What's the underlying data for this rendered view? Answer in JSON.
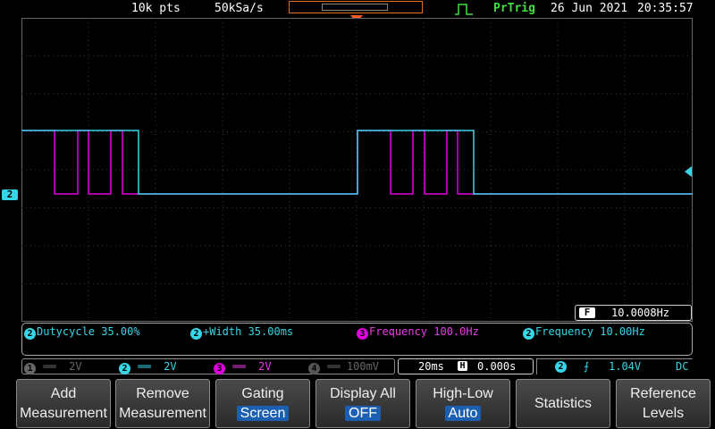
{
  "top_bar": {
    "points": "10k pts",
    "sample_rate": "50kSa/s",
    "trigger_status": "PrTrig",
    "date": "26 Jun 2021",
    "time": "20:35:57"
  },
  "channel_marker": "2",
  "frequency_counter": {
    "icon": "F",
    "value": "10.0008Hz"
  },
  "measurements": [
    {
      "channel": "2",
      "text": "Dutycycle 35.00%",
      "color": "#35d6e8"
    },
    {
      "channel": "2",
      "text": "+Width 35.00ms",
      "color": "#35d6e8"
    },
    {
      "channel": "3",
      "text": "Frequency 100.0Hz",
      "color": "#e83ce8"
    },
    {
      "channel": "2",
      "text": "Frequency 10.00Hz",
      "color": "#35d6e8"
    }
  ],
  "channel_status": [
    {
      "ch": "1",
      "scale": "2V"
    },
    {
      "ch": "2",
      "scale": "2V"
    },
    {
      "ch": "3",
      "scale": "2V"
    },
    {
      "ch": "4",
      "scale": "100mV"
    }
  ],
  "timebase": {
    "scale": "20ms",
    "icon": "H",
    "position": "0.000s"
  },
  "trigger": {
    "ch": "2",
    "level": "1.04V",
    "coupling": "DC"
  },
  "softkeys": {
    "add": {
      "l1": "Add",
      "l2": "Measurement"
    },
    "remove": {
      "l1": "Remove",
      "l2": "Measurement"
    },
    "gating": {
      "l1": "Gating",
      "l2": "Screen"
    },
    "display_all": {
      "l1": "Display All",
      "l2": "OFF"
    },
    "high_low": {
      "l1": "High-Low",
      "l2": "Auto"
    },
    "statistics": {
      "l1": "Statistics"
    },
    "reference": {
      "l1": "Reference",
      "l2": "Levels"
    }
  },
  "colors": {
    "ch2": "#35d6e8",
    "ch3": "#e000e0",
    "accent": "#1b5fb0",
    "trigger_marker": "#ff5a1f"
  }
}
